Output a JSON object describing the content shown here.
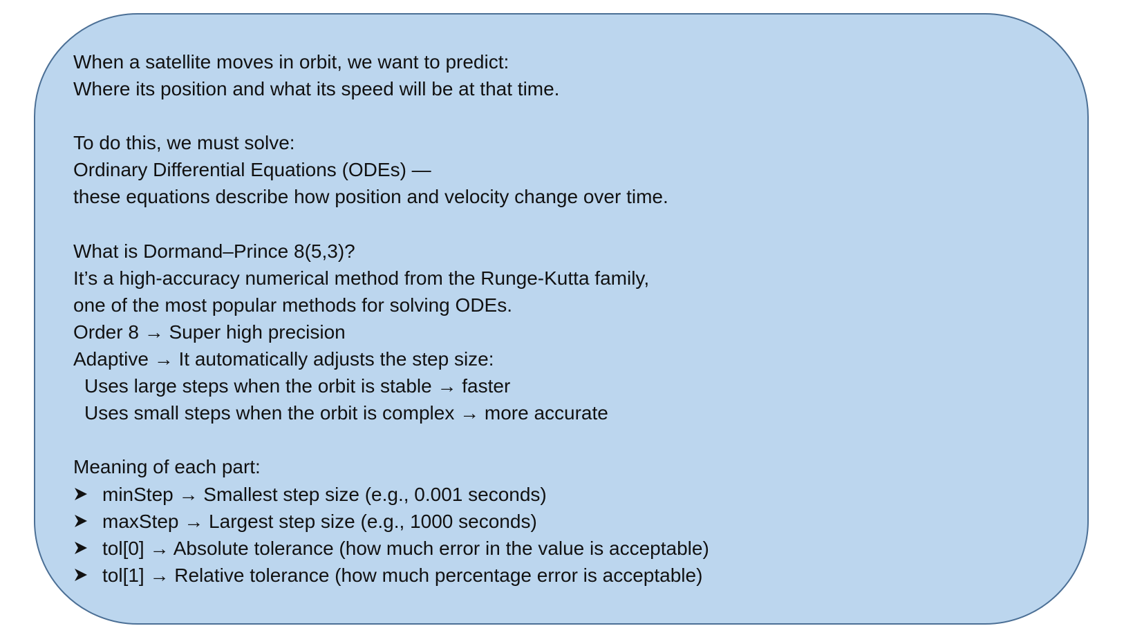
{
  "content": {
    "intro": [
      "When a satellite moves in orbit, we want to predict:",
      "Where its position and what its speed will be at that time."
    ],
    "solve": [
      "To do this, we must solve:",
      "Ordinary Differential Equations (ODEs) —",
      "these equations describe how position and velocity change over time."
    ],
    "method": [
      "What is Dormand–Prince 8(5,3)?",
      "It’s a high-accuracy numerical method from the Runge-Kutta family,",
      "one of the most popular methods for solving ODEs.",
      "Order 8 → Super high precision",
      "Adaptive → It automatically adjusts the step size:"
    ],
    "adaptive_details": [
      "Uses large steps when the orbit is stable → faster",
      "Uses small steps when the orbit is complex → more accurate"
    ],
    "meaning_heading": "Meaning of each part:",
    "meaning_bullets": [
      "minStep → Smallest step size (e.g., 0.001 seconds)",
      "maxStep → Largest step size (e.g., 1000 seconds)",
      "tol[0] → Absolute tolerance (how much error in the value is acceptable)",
      "tol[1] → Relative tolerance (how much percentage error is acceptable)"
    ],
    "bullet_icon": "arrowhead-bullet-icon"
  },
  "colors": {
    "box_fill": "#bcd6ee",
    "box_border": "#4b6f95",
    "text": "#111111"
  }
}
